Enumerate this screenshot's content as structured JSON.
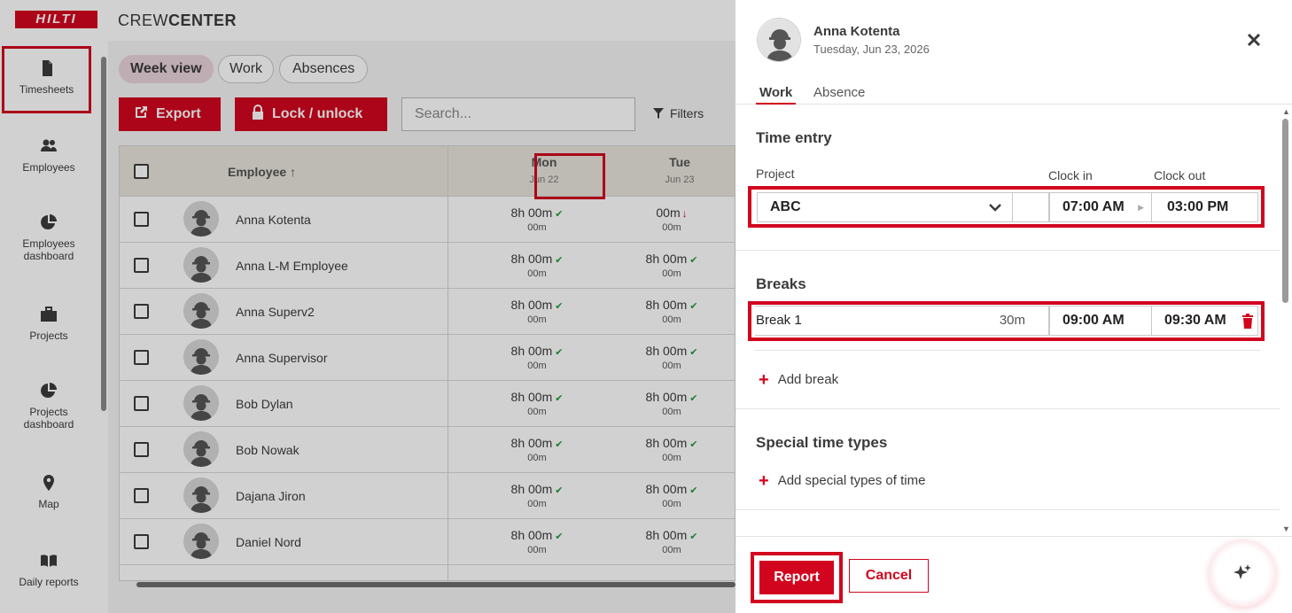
{
  "app": {
    "brand": "HILTI",
    "name_light": "CREW",
    "name_bold": "CENTER"
  },
  "sidebar": {
    "items": [
      {
        "label": "Timesheets",
        "icon": "document-icon",
        "active": true
      },
      {
        "label": "Employees",
        "icon": "people-icon"
      },
      {
        "label": "Employees dashboard",
        "icon": "pie-chart-icon"
      },
      {
        "label": "Projects",
        "icon": "briefcase-icon"
      },
      {
        "label": "Projects dashboard",
        "icon": "pie-chart-icon"
      },
      {
        "label": "Map",
        "icon": "map-pin-icon"
      },
      {
        "label": "Daily reports",
        "icon": "book-icon"
      }
    ]
  },
  "main": {
    "view_tabs": [
      "Week view",
      "Work",
      "Absences"
    ],
    "export_label": "Export",
    "lock_label": "Lock / unlock",
    "search_placeholder": "Search...",
    "filters_label": "Filters",
    "table": {
      "employee_header": "Employee",
      "days": [
        {
          "day": "Mon",
          "date": "Jun 22"
        },
        {
          "day": "Tue",
          "date": "Jun 23"
        }
      ],
      "rows": [
        {
          "name": "Anna Kotenta",
          "mon": "8h 00m",
          "mon_sub": "00m",
          "tue": "00m",
          "tue_sub": "00m",
          "tue_status": "down"
        },
        {
          "name": "Anna L-M Employee",
          "mon": "8h 00m",
          "mon_sub": "00m",
          "tue": "8h 00m",
          "tue_sub": "00m",
          "tue_status": "ok"
        },
        {
          "name": "Anna Superv2",
          "mon": "8h 00m",
          "mon_sub": "00m",
          "tue": "8h 00m",
          "tue_sub": "00m",
          "tue_status": "ok"
        },
        {
          "name": "Anna Supervisor",
          "mon": "8h 00m",
          "mon_sub": "00m",
          "tue": "8h 00m",
          "tue_sub": "00m",
          "tue_status": "ok"
        },
        {
          "name": "Bob Dylan",
          "mon": "8h 00m",
          "mon_sub": "00m",
          "tue": "8h 00m",
          "tue_sub": "00m",
          "tue_status": "ok"
        },
        {
          "name": "Bob Nowak",
          "mon": "8h 00m",
          "mon_sub": "00m",
          "tue": "8h 00m",
          "tue_sub": "00m",
          "tue_status": "ok"
        },
        {
          "name": "Dajana Jiron",
          "mon": "8h 00m",
          "mon_sub": "00m",
          "tue": "8h 00m",
          "tue_sub": "00m",
          "tue_status": "ok"
        },
        {
          "name": "Daniel Nord",
          "mon": "8h 00m",
          "mon_sub": "00m",
          "tue": "8h 00m",
          "tue_sub": "00m",
          "tue_status": "ok"
        }
      ]
    }
  },
  "drawer": {
    "employee_name": "Anna Kotenta",
    "date": "Tuesday, Jun 23, 2026",
    "tabs": [
      "Work",
      "Absence"
    ],
    "time_entry": {
      "title": "Time entry",
      "project_label": "Project",
      "clock_in_label": "Clock in",
      "clock_out_label": "Clock out",
      "project_value": "ABC",
      "clock_in": "07:00 AM",
      "clock_out": "03:00 PM"
    },
    "breaks": {
      "title": "Breaks",
      "items": [
        {
          "name": "Break 1",
          "duration": "30m",
          "start": "09:00 AM",
          "end": "09:30 AM"
        }
      ],
      "add_label": "Add break"
    },
    "special": {
      "title": "Special time types",
      "add_label": "Add special types of time"
    },
    "report_label": "Report",
    "cancel_label": "Cancel"
  },
  "colors": {
    "brand_red": "#d2051e",
    "active_tab_bg": "#e9d3dc",
    "ok_green": "#1f9d3a"
  }
}
